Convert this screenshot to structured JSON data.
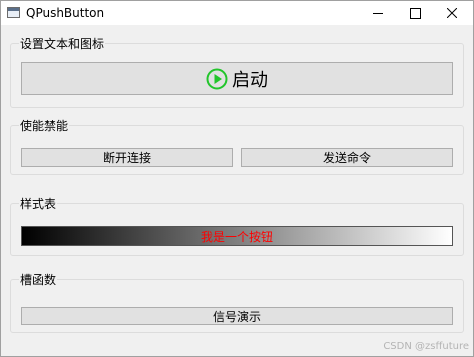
{
  "window": {
    "title": "QPushButton"
  },
  "groups": {
    "text_icon": {
      "title": "设置文本和图标",
      "button_label": "启动",
      "button_icon": "play-circle-icon",
      "icon_color": "#22c52b"
    },
    "enable": {
      "title": "使能禁能",
      "left_label": "断开连接",
      "right_label": "发送命令"
    },
    "stylesheet": {
      "title": "样式表",
      "button_label": "我是一个按钮",
      "text_color": "#ff0000",
      "gradient_from": "#000000",
      "gradient_to": "#ffffff"
    },
    "slot": {
      "title": "槽函数",
      "button_label": "信号演示"
    }
  },
  "watermark": "CSDN @zsffuture"
}
